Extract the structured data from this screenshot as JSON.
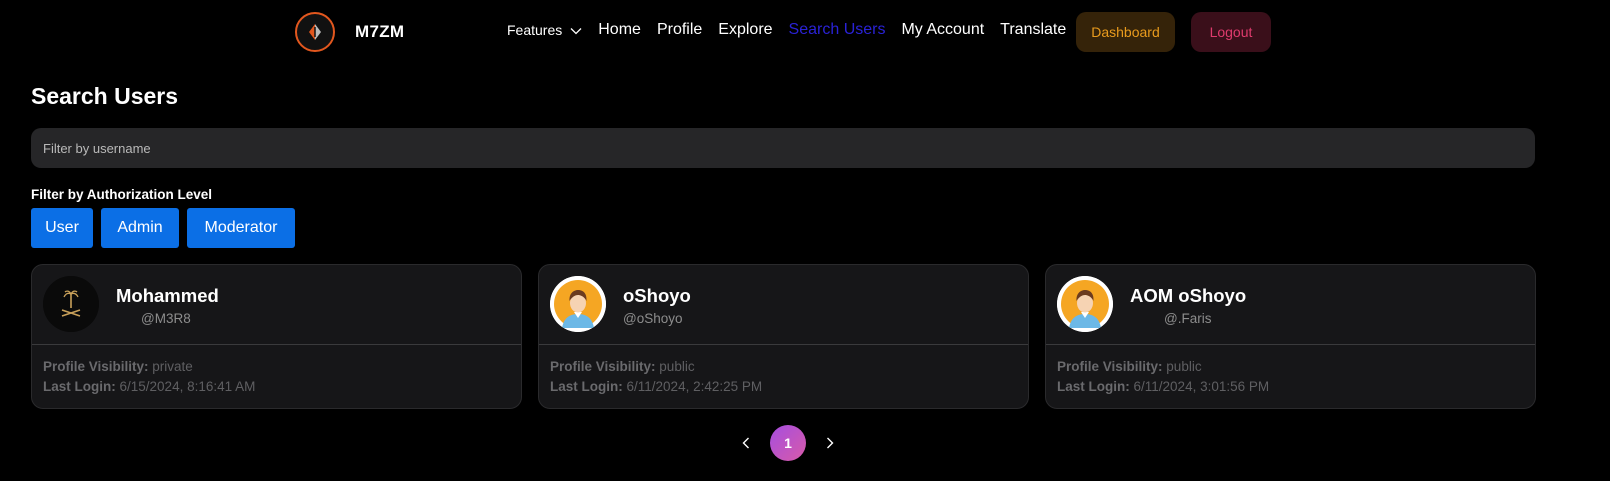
{
  "nav": {
    "brand": "M7ZM",
    "features_label": "Features",
    "links": [
      "Home",
      "Profile",
      "Explore",
      "Search Users",
      "My Account",
      "Translate"
    ],
    "active_link": "Search Users",
    "dashboard_label": "Dashboard",
    "logout_label": "Logout"
  },
  "page": {
    "title": "Search Users",
    "search_placeholder": "Filter by username",
    "search_value": "",
    "filter_label": "Filter by Authorization Level",
    "filters": [
      "User",
      "Admin",
      "Moderator"
    ]
  },
  "users": [
    {
      "name": "Mohammed",
      "handle": "@M3R8",
      "visibility_label": "Profile Visibility:",
      "visibility": "private",
      "login_label": "Last Login:",
      "last_login": "6/15/2024, 8:16:41 AM",
      "avatar": "emblem-icon"
    },
    {
      "name": "oShoyo",
      "handle": "@oShoyo",
      "visibility_label": "Profile Visibility:",
      "visibility": "public",
      "login_label": "Last Login:",
      "last_login": "6/11/2024, 2:42:25 PM",
      "avatar": "default-user-avatar"
    },
    {
      "name": "AOM oShoyo",
      "handle": "@.Faris",
      "visibility_label": "Profile Visibility:",
      "visibility": "public",
      "login_label": "Last Login:",
      "last_login": "6/11/2024, 3:01:56 PM",
      "avatar": "default-user-avatar"
    }
  ],
  "pagination": {
    "current_page": "1"
  },
  "colors": {
    "background": "#000000",
    "active_link": "#2a22d6",
    "dashboard_text": "#e99b1d",
    "logout_text": "#df3b6d",
    "filter_button": "#0b6fe6",
    "logo_ring": "#e2571e"
  }
}
